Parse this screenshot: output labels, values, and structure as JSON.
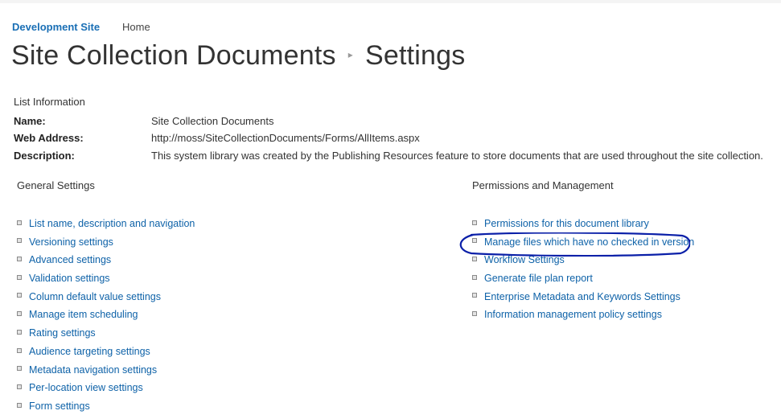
{
  "breadcrumb": {
    "site": "Development Site",
    "home": "Home"
  },
  "page_title": {
    "part1": "Site Collection Documents",
    "part2": "Settings"
  },
  "list_info": {
    "heading": "List Information",
    "rows": [
      {
        "label": "Name:",
        "value": "Site Collection Documents"
      },
      {
        "label": "Web Address:",
        "value": "http://moss/SiteCollectionDocuments/Forms/AllItems.aspx"
      },
      {
        "label": "Description:",
        "value": "This system library was created by the Publishing Resources feature to store documents that are used throughout the site collection."
      }
    ]
  },
  "general_settings": {
    "heading": "General Settings",
    "links": [
      "List name, description and navigation",
      "Versioning settings",
      "Advanced settings",
      "Validation settings",
      "Column default value settings",
      "Manage item scheduling",
      "Rating settings",
      "Audience targeting settings",
      "Metadata navigation settings",
      "Per-location view settings",
      "Form settings"
    ]
  },
  "permissions_management": {
    "heading": "Permissions and Management",
    "links": [
      "Permissions for this document library",
      "Manage files which have no checked in version",
      "Workflow Settings",
      "Generate file plan report",
      "Enterprise Metadata and Keywords Settings",
      "Information management policy settings"
    ]
  },
  "annotation": {
    "color": "#0a1fa8"
  },
  "colors": {
    "link": "#0e62a8",
    "site_link": "#1a6fb5"
  }
}
